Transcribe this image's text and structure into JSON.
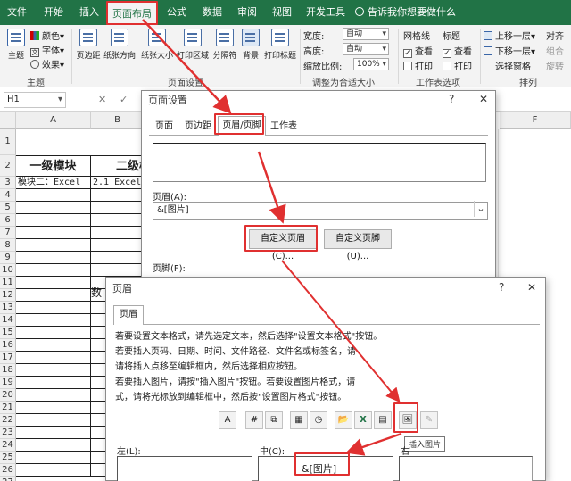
{
  "tabs": [
    "文件",
    "开始",
    "插入",
    "页面布局",
    "公式",
    "数据",
    "审阅",
    "视图",
    "开发工具"
  ],
  "tell_me": "告诉我你想要做什么",
  "ribbon": {
    "theme": "主题",
    "colors": "颜色",
    "fonts": "字体",
    "effects": "效果",
    "themes_group": "主题",
    "margins": "页边距",
    "orientation": "纸张方向",
    "size": "纸张大小",
    "print_area": "打印区域",
    "breaks": "分隔符",
    "background": "背景",
    "print_titles": "打印标题",
    "page_setup_group": "页面设置",
    "width_label": "宽度:",
    "width_value": "自动",
    "height_label": "高度:",
    "height_value": "自动",
    "scale_label": "缩放比例:",
    "scale_value": "100%",
    "scale_group": "调整为合适大小",
    "gridlines": "网格线",
    "headings": "标题",
    "view": "查看",
    "print": "打印",
    "sheet_options_group": "工作表选项",
    "bring_forward": "上移一层",
    "send_backward": "下移一层",
    "selection_pane": "选择窗格",
    "align": "对齐",
    "group": "组合",
    "rotate": "旋转",
    "arrange_group": "排列"
  },
  "formula_bar": {
    "name_box": "H1",
    "cancel": "✕",
    "enter": "✓"
  },
  "grid": {
    "columns": [
      "A",
      "B",
      "F"
    ],
    "rows": [
      "1",
      "2",
      "3",
      "4",
      "5",
      "6",
      "7",
      "8",
      "9",
      "10",
      "11",
      "12",
      "13",
      "14",
      "15",
      "16",
      "17",
      "18",
      "19",
      "20",
      "21",
      "22",
      "23",
      "24",
      "25",
      "26",
      "27"
    ],
    "header_a": "一级模块",
    "header_b": "二级模",
    "a3": "模块二：Excel",
    "b3": "2.1 Excel",
    "b12": "数"
  },
  "page_setup": {
    "title": "页面设置",
    "help": "?",
    "close": "✕",
    "tabs": [
      "页面",
      "页边距",
      "页眉/页脚",
      "工作表"
    ],
    "header_label": "页眉(A):",
    "header_value": "&[图片]",
    "custom_header_btn": "自定义页眉(C)...",
    "custom_footer_btn": "自定义页脚(U)...",
    "footer_label": "页脚(F):"
  },
  "header_dialog": {
    "title": "页眉",
    "help": "?",
    "close": "✕",
    "tab": "页眉",
    "instructions": [
      "若要设置文本格式，请先选定文本，然后选择\"设置文本格式\"按钮。",
      "若要插入页码、日期、时间、文件路径、文件名或标签名，请",
      "    请将插入点移至编辑框内，然后选择相应按钮。",
      "若要插入图片，请按\"插入图片\"按钮。若要设置图片格式，请",
      "    式，请将光标放到编辑框中，然后按\"设置图片格式\"按钮。"
    ],
    "toolbar": [
      "A",
      "#",
      "⧉",
      "▦",
      "◷",
      "📂",
      "X",
      "▤",
      "🖼",
      "✎"
    ],
    "tooltip": "插入图片",
    "left_label": "左(L):",
    "center_label": "中(C):",
    "right_label": "右",
    "center_value": "&[图片]"
  },
  "colors": {
    "excel_green": "#217346",
    "highlight_red": "#e03030"
  }
}
